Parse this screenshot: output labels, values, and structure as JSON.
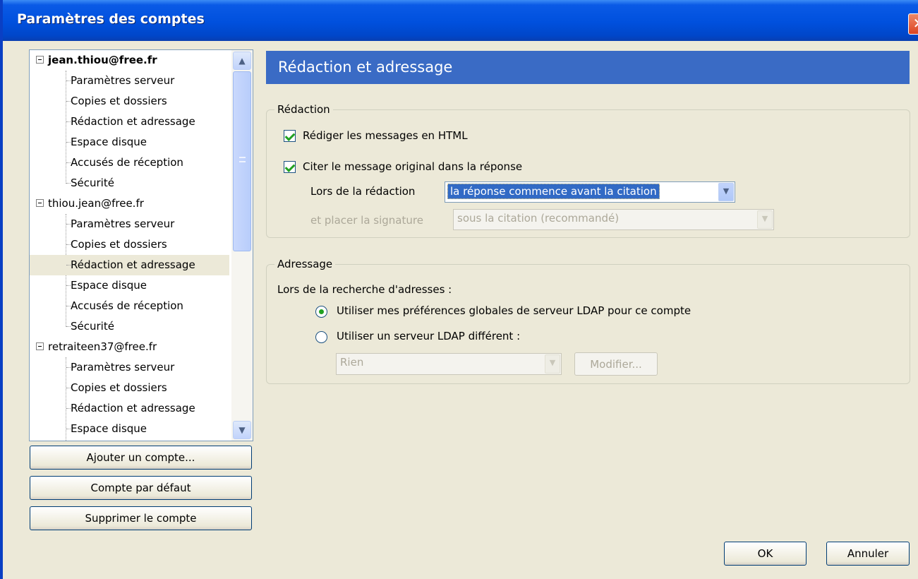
{
  "window": {
    "title": "Paramètres des comptes",
    "close_glyph": "✕"
  },
  "tree": {
    "accounts": [
      {
        "name": "jean.thiou@free.fr",
        "children": [
          "Paramètres serveur",
          "Copies et dossiers",
          "Rédaction et adressage",
          "Espace disque",
          "Accusés de réception",
          "Sécurité"
        ]
      },
      {
        "name": "thiou.jean@free.fr",
        "children": [
          "Paramètres serveur",
          "Copies et dossiers",
          "Rédaction et adressage",
          "Espace disque",
          "Accusés de réception",
          "Sécurité"
        ]
      },
      {
        "name": "retraiteen37@free.fr",
        "children": [
          "Paramètres serveur",
          "Copies et dossiers",
          "Rédaction et adressage",
          "Espace disque"
        ]
      }
    ],
    "selected": "thiou.jean@free.fr / Rédaction et adressage"
  },
  "left_buttons": {
    "add_account": "Ajouter un compte...",
    "default_account": "Compte par défaut",
    "delete_account": "Supprimer le compte"
  },
  "panel": {
    "title": "Rédaction et adressage",
    "composition": {
      "legend": "Rédaction",
      "html_label": "Rédiger les messages en HTML",
      "html_checked": true,
      "quote_label": "Citer le message original dans la réponse",
      "quote_checked": true,
      "reply_label": "Lors de la rédaction",
      "reply_value": "la réponse commence avant la citation",
      "signature_label": "et placer la signature",
      "signature_value": "sous la citation (recommandé)"
    },
    "addressing": {
      "legend": "Adressage",
      "lookup_label": "Lors de la recherche d'adresses :",
      "global_ldap_label": "Utiliser mes préférences globales de serveur LDAP pour ce compte",
      "different_ldap_label": "Utiliser un serveur LDAP différent :",
      "selected_option": "global",
      "ldap_server_value": "Rien",
      "edit_button": "Modifier..."
    }
  },
  "footer": {
    "ok": "OK",
    "cancel": "Annuler"
  },
  "colors": {
    "title_bar": "#0050dd",
    "header_bg": "#3a6bc5",
    "window_bg": "#ece9d8",
    "check": "#21a121"
  },
  "icons": {
    "scroll_up": "▲",
    "scroll_down": "▼",
    "dropdown": "▼"
  }
}
